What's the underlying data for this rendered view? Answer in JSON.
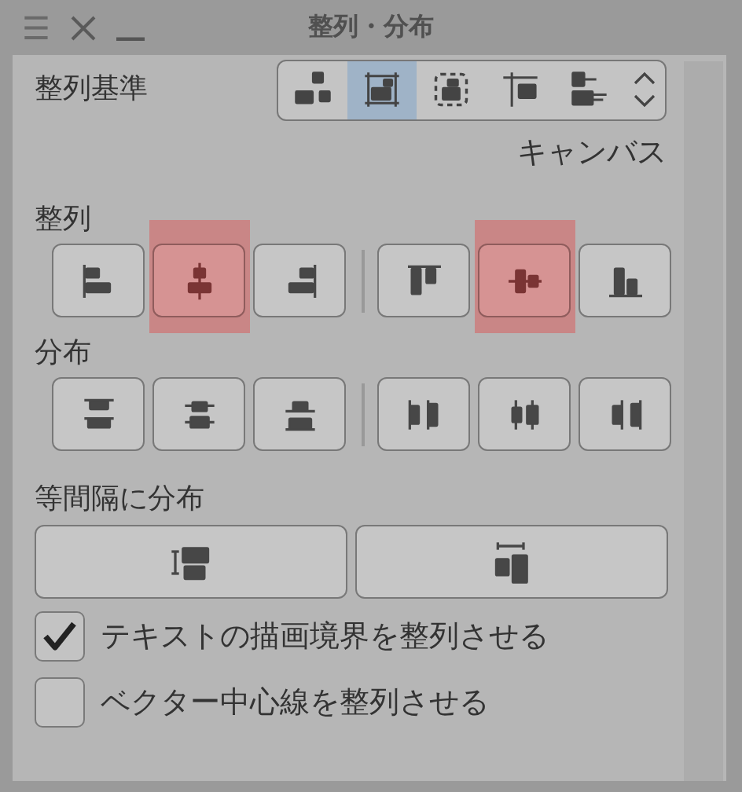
{
  "window": {
    "title": "整列・分布",
    "menu_icon": "☰"
  },
  "basis": {
    "label": "整列基準",
    "value": "キャンバス",
    "options": [
      {
        "kind": "selection",
        "selected": false
      },
      {
        "kind": "canvas",
        "selected": true
      },
      {
        "kind": "dashed",
        "selected": false
      },
      {
        "kind": "line",
        "selected": false
      },
      {
        "kind": "guide",
        "selected": false
      }
    ]
  },
  "align": {
    "label": "整列",
    "buttons": [
      {
        "kind": "align_left",
        "selected": false
      },
      {
        "kind": "align_hcenter",
        "selected": true
      },
      {
        "kind": "align_right",
        "selected": false
      },
      {
        "kind": "align_top",
        "selected": false
      },
      {
        "kind": "align_vcenter",
        "selected": true
      },
      {
        "kind": "align_bottom",
        "selected": false
      }
    ]
  },
  "distribute": {
    "label": "分布",
    "buttons": [
      {
        "kind": "dist_top",
        "selected": false
      },
      {
        "kind": "dist_vcenter",
        "selected": false
      },
      {
        "kind": "dist_bottom",
        "selected": false
      },
      {
        "kind": "dist_left",
        "selected": false
      },
      {
        "kind": "dist_hcenter",
        "selected": false
      },
      {
        "kind": "dist_right",
        "selected": false
      }
    ]
  },
  "spacing": {
    "label": "等間隔に分布",
    "buttons": [
      {
        "kind": "space_v"
      },
      {
        "kind": "space_h"
      }
    ]
  },
  "options": [
    {
      "label": "テキストの描画境界を整列させる",
      "checked": true
    },
    {
      "label": "ベクター中心線を整列させる",
      "checked": false
    }
  ]
}
